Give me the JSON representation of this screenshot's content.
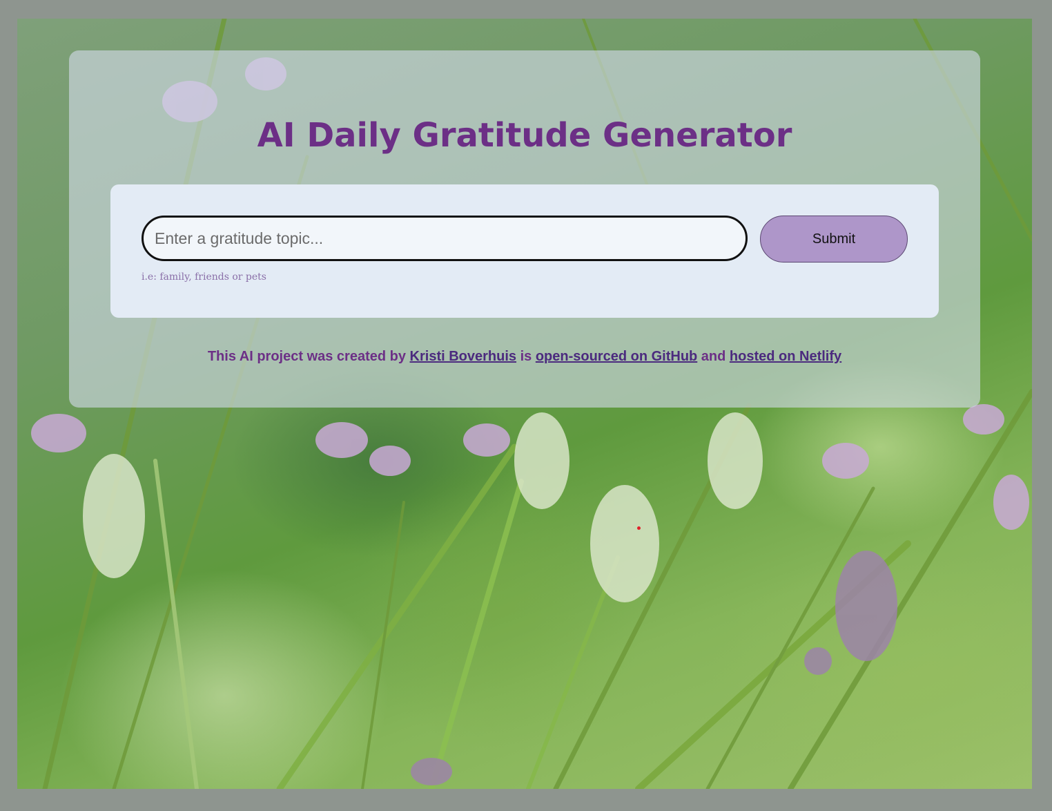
{
  "app": {
    "title": "AI Daily Gratitude Generator"
  },
  "form": {
    "input_placeholder": "Enter a gratitude topic...",
    "input_value": "",
    "submit_label": "Submit",
    "hint": "i.e: family, friends or pets"
  },
  "footer": {
    "text_1": "This AI project was created by ",
    "author_link": "Kristi Boverhuis",
    "text_2": " is ",
    "github_link": "open-sourced on GitHub",
    "text_3": " and ",
    "netlify_link": "hosted on Netlify"
  },
  "colors": {
    "title": "#6c2f86",
    "button": "#ae96c9",
    "link": "#4b2a7e",
    "page_border": "#8e958f"
  },
  "background": {
    "image": "lavender-flowers-photo"
  }
}
